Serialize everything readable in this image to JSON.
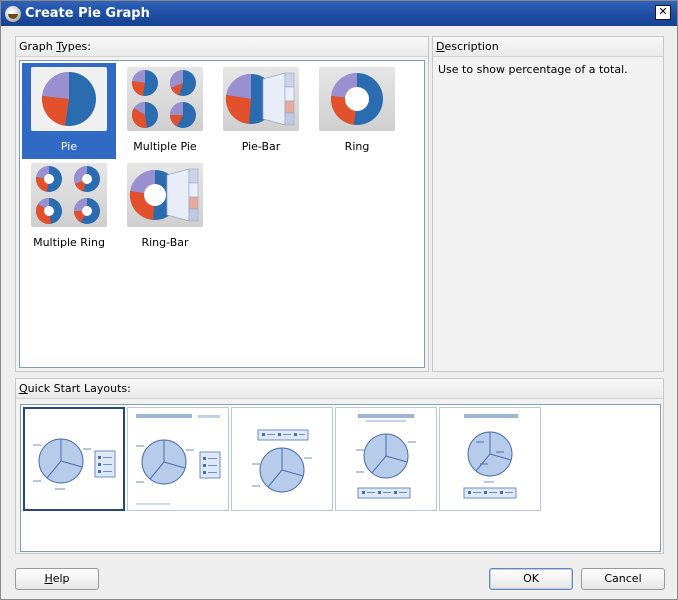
{
  "window": {
    "title": "Create Pie Graph",
    "close_glyph": "✕"
  },
  "graph_types": {
    "header_prefix": "Graph ",
    "header_mnemonic": "T",
    "header_suffix": "ypes:",
    "items": [
      {
        "label": "Pie",
        "icon": "pie-icon",
        "selected": true
      },
      {
        "label": "Multiple Pie",
        "icon": "multiple-pie-icon",
        "selected": false
      },
      {
        "label": "Pie-Bar",
        "icon": "pie-bar-icon",
        "selected": false
      },
      {
        "label": "Ring",
        "icon": "ring-icon",
        "selected": false
      },
      {
        "label": "Multiple Ring",
        "icon": "multiple-ring-icon",
        "selected": false
      },
      {
        "label": "Ring-Bar",
        "icon": "ring-bar-icon",
        "selected": false
      }
    ]
  },
  "description": {
    "header_mnemonic": "D",
    "header_suffix": "escription",
    "text": "Use to show percentage of a total."
  },
  "quick_start": {
    "header_mnemonic": "Q",
    "header_suffix": "uick Start Layouts:",
    "layouts": [
      {
        "icon": "layout-legend-right-icon",
        "selected": true
      },
      {
        "icon": "layout-title-legend-right-icon",
        "selected": false
      },
      {
        "icon": "layout-legend-top-icon",
        "selected": false
      },
      {
        "icon": "layout-title-legend-bottom-icon",
        "selected": false
      },
      {
        "icon": "layout-title-legend-bottom-small-icon",
        "selected": false
      }
    ]
  },
  "buttons": {
    "help_mnemonic": "H",
    "help_suffix": "elp",
    "ok": "OK",
    "cancel": "Cancel"
  },
  "colors": {
    "selection": "#316ac5",
    "pie_blue": "#2b6bb0",
    "pie_red": "#e2502c",
    "pie_purple": "#9a8fcf",
    "layout_blue": "#7ea1d4"
  }
}
